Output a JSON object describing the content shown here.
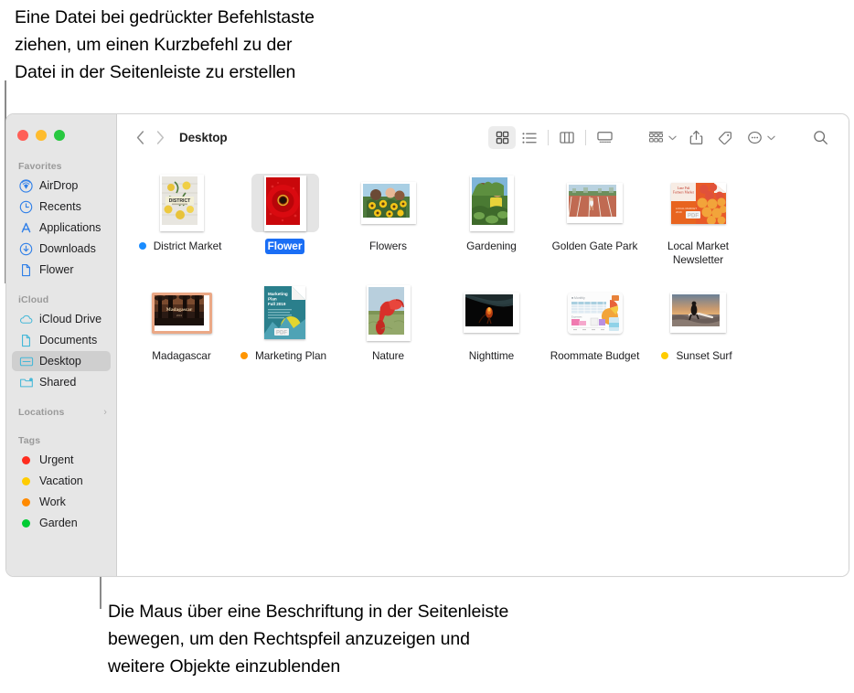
{
  "captions": {
    "top": "Eine Datei bei gedrückter Befehlstaste\nziehen, um einen Kurzbefehl zu der\nDatei in der Seitenleiste zu erstellen",
    "bottom": "Die Maus über eine Beschriftung in der Seitenleiste\nbewegen, um den Rechtspfeil anzuzeigen und\nweitere Objekte einzublenden"
  },
  "window": {
    "traffic_lights": {
      "close": "#ff5f57",
      "minimize": "#febc2e",
      "zoom": "#28c840"
    }
  },
  "toolbar": {
    "back_label": "‹",
    "forward_label": "›",
    "path_title": "Desktop",
    "views": [
      {
        "name": "icon-view-button",
        "label": "Symbolansicht",
        "active": true
      },
      {
        "name": "list-view-button",
        "label": "Listenansicht",
        "active": false
      },
      {
        "name": "column-view-button",
        "label": "Spaltenansicht",
        "active": false
      },
      {
        "name": "gallery-view-button",
        "label": "Galerieansicht",
        "active": false
      }
    ],
    "actions": [
      {
        "name": "group-by-button",
        "label": "Gruppieren nach"
      },
      {
        "name": "share-button",
        "label": "Teilen"
      },
      {
        "name": "tags-button",
        "label": "Tags"
      },
      {
        "name": "more-actions-button",
        "label": "Weitere Aktionen"
      },
      {
        "name": "search-button",
        "label": "Suchen"
      }
    ]
  },
  "sidebar": {
    "sections": [
      {
        "title": "Favorites",
        "chevron": "",
        "items": [
          {
            "label": "AirDrop",
            "icon": "airdrop-icon",
            "selected": false
          },
          {
            "label": "Recents",
            "icon": "clock-icon",
            "selected": false
          },
          {
            "label": "Applications",
            "icon": "applications-icon",
            "selected": false
          },
          {
            "label": "Downloads",
            "icon": "download-icon",
            "selected": false
          },
          {
            "label": "Flower",
            "icon": "document-icon",
            "selected": false
          }
        ]
      },
      {
        "title": "iCloud",
        "chevron": "",
        "items": [
          {
            "label": "iCloud Drive",
            "icon": "cloud-icon",
            "selected": false
          },
          {
            "label": "Documents",
            "icon": "document-icon",
            "selected": false
          },
          {
            "label": "Desktop",
            "icon": "desktop-icon",
            "selected": true
          },
          {
            "label": "Shared",
            "icon": "shared-folder-icon",
            "selected": false
          }
        ]
      },
      {
        "title": "Locations",
        "chevron": "›",
        "items": []
      },
      {
        "title": "Tags",
        "chevron": "",
        "items": [
          {
            "label": "Urgent",
            "icon": "tag-dot-icon",
            "color": "#ff2d1f",
            "selected": false
          },
          {
            "label": "Vacation",
            "icon": "tag-dot-icon",
            "color": "#ffcc00",
            "selected": false
          },
          {
            "label": "Work",
            "icon": "tag-dot-icon",
            "color": "#ff8a00",
            "selected": false
          },
          {
            "label": "Garden",
            "icon": "tag-dot-icon",
            "color": "#00cc33",
            "selected": false
          }
        ]
      }
    ]
  },
  "files": [
    {
      "name": "District Market",
      "thumb": "district-market-thumb",
      "tag_color": "#1a8cff",
      "selected": false
    },
    {
      "name": "Flower",
      "thumb": "flower-thumb",
      "tag_color": "",
      "selected": true
    },
    {
      "name": "Flowers",
      "thumb": "flowers-thumb",
      "tag_color": "",
      "selected": false
    },
    {
      "name": "Gardening",
      "thumb": "gardening-thumb",
      "tag_color": "",
      "selected": false
    },
    {
      "name": "Golden Gate Park",
      "thumb": "golden-gate-park-thumb",
      "tag_color": "",
      "selected": false
    },
    {
      "name": "Local Market Newsletter",
      "thumb": "local-market-thumb",
      "tag_color": "",
      "selected": false
    },
    {
      "name": "Madagascar",
      "thumb": "madagascar-thumb",
      "tag_color": "",
      "selected": false
    },
    {
      "name": "Marketing Plan",
      "thumb": "marketing-plan-thumb",
      "tag_color": "#ff9500",
      "selected": false
    },
    {
      "name": "Nature",
      "thumb": "nature-thumb",
      "tag_color": "",
      "selected": false
    },
    {
      "name": "Nighttime",
      "thumb": "nighttime-thumb",
      "tag_color": "",
      "selected": false
    },
    {
      "name": "Roommate Budget",
      "thumb": "roommate-budget-thumb",
      "tag_color": "",
      "selected": false
    },
    {
      "name": "Sunset Surf",
      "thumb": "sunset-surf-thumb",
      "tag_color": "#ffcc00",
      "selected": false
    }
  ]
}
